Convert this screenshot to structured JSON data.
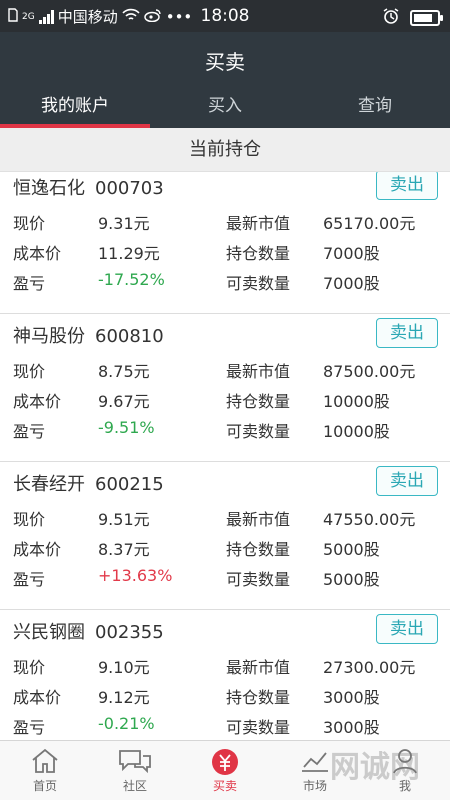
{
  "status_bar": {
    "carrier": "中国移动",
    "net": "2G",
    "time": "18:08",
    "dots": "•••"
  },
  "header": {
    "title": "买卖",
    "tabs": [
      {
        "label": "我的账户",
        "active": true
      },
      {
        "label": "买入",
        "active": false
      },
      {
        "label": "查询",
        "active": false
      }
    ]
  },
  "section": {
    "title": "当前持仓"
  },
  "labels": {
    "price": "现价",
    "cost": "成本价",
    "pnl": "盈亏",
    "market_value": "最新市值",
    "hold_qty": "持仓数量",
    "sell_qty": "可卖数量",
    "sell_button": "卖出"
  },
  "positions": [
    {
      "name": "恒逸石化",
      "code": "000703",
      "price": "9.31元",
      "cost": "11.29元",
      "pnl": "-17.52%",
      "pnl_color": "#2fa84f",
      "market_value": "65170.00元",
      "hold_qty": "7000股",
      "sell_qty": "7000股"
    },
    {
      "name": "神马股份",
      "code": "600810",
      "price": "8.75元",
      "cost": "9.67元",
      "pnl": "-9.51%",
      "pnl_color": "#2fa84f",
      "market_value": "87500.00元",
      "hold_qty": "10000股",
      "sell_qty": "10000股"
    },
    {
      "name": "长春经开",
      "code": "600215",
      "price": "9.51元",
      "cost": "8.37元",
      "pnl": "+13.63%",
      "pnl_color": "#e23a4a",
      "market_value": "47550.00元",
      "hold_qty": "5000股",
      "sell_qty": "5000股"
    },
    {
      "name": "兴民钢圈",
      "code": "002355",
      "price": "9.10元",
      "cost": "9.12元",
      "pnl": "-0.21%",
      "pnl_color": "#2fa84f",
      "market_value": "27300.00元",
      "hold_qty": "3000股",
      "sell_qty": "3000股"
    }
  ],
  "bottom_nav": [
    {
      "label": "首页",
      "icon": "home-icon"
    },
    {
      "label": "社区",
      "icon": "chat-icon"
    },
    {
      "label": "买卖",
      "icon": "trade-icon",
      "active": true
    },
    {
      "label": "市场",
      "icon": "market-icon"
    },
    {
      "label": "我",
      "icon": "user-icon"
    }
  ],
  "watermark": "网诚网",
  "colors": {
    "header_bg": "#303940",
    "accent": "#e03546",
    "sell_button": "#2aa7b4",
    "loss": "#2fa84f",
    "gain": "#e23a4a"
  }
}
